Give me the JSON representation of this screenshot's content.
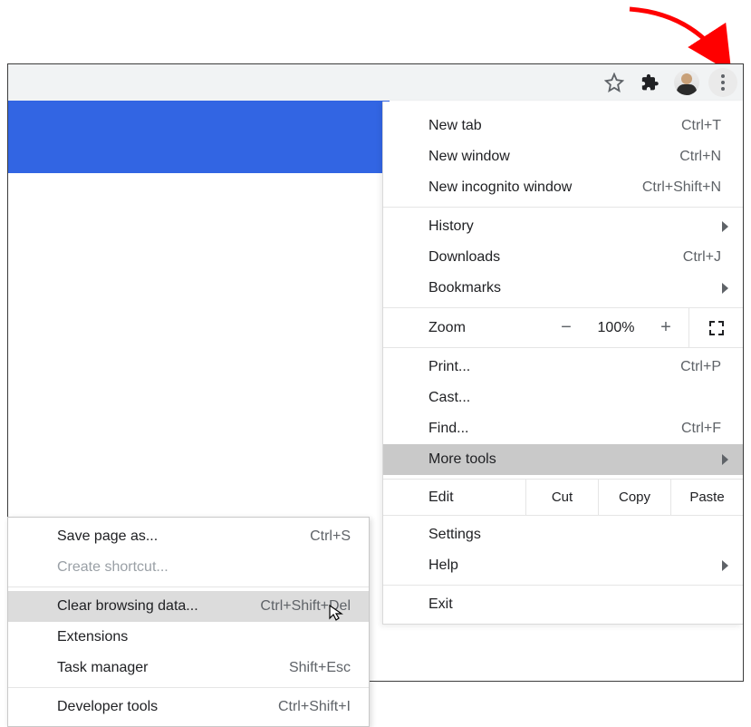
{
  "toolbar": {
    "star_title": "Bookmark this tab",
    "extensions_title": "Extensions",
    "profile_title": "Profile",
    "menu_title": "Customize and control Google Chrome"
  },
  "menu": {
    "new_tab": {
      "label": "New tab",
      "shortcut": "Ctrl+T"
    },
    "new_window": {
      "label": "New window",
      "shortcut": "Ctrl+N"
    },
    "new_incog": {
      "label": "New incognito window",
      "shortcut": "Ctrl+Shift+N"
    },
    "history": {
      "label": "History"
    },
    "downloads": {
      "label": "Downloads",
      "shortcut": "Ctrl+J"
    },
    "bookmarks": {
      "label": "Bookmarks"
    },
    "zoom": {
      "label": "Zoom",
      "value": "100%",
      "minus": "−",
      "plus": "+"
    },
    "print": {
      "label": "Print...",
      "shortcut": "Ctrl+P"
    },
    "cast": {
      "label": "Cast..."
    },
    "find": {
      "label": "Find...",
      "shortcut": "Ctrl+F"
    },
    "more_tools": {
      "label": "More tools"
    },
    "edit": {
      "label": "Edit",
      "cut": "Cut",
      "copy": "Copy",
      "paste": "Paste"
    },
    "settings": {
      "label": "Settings"
    },
    "help": {
      "label": "Help"
    },
    "exit": {
      "label": "Exit"
    }
  },
  "submenu": {
    "save_page": {
      "label": "Save page as...",
      "shortcut": "Ctrl+S"
    },
    "create_shortcut": {
      "label": "Create shortcut..."
    },
    "clear_browsing": {
      "label": "Clear browsing data...",
      "shortcut": "Ctrl+Shift+Del"
    },
    "extensions": {
      "label": "Extensions"
    },
    "task_manager": {
      "label": "Task manager",
      "shortcut": "Shift+Esc"
    },
    "dev_tools": {
      "label": "Developer tools",
      "shortcut": "Ctrl+Shift+I"
    }
  }
}
